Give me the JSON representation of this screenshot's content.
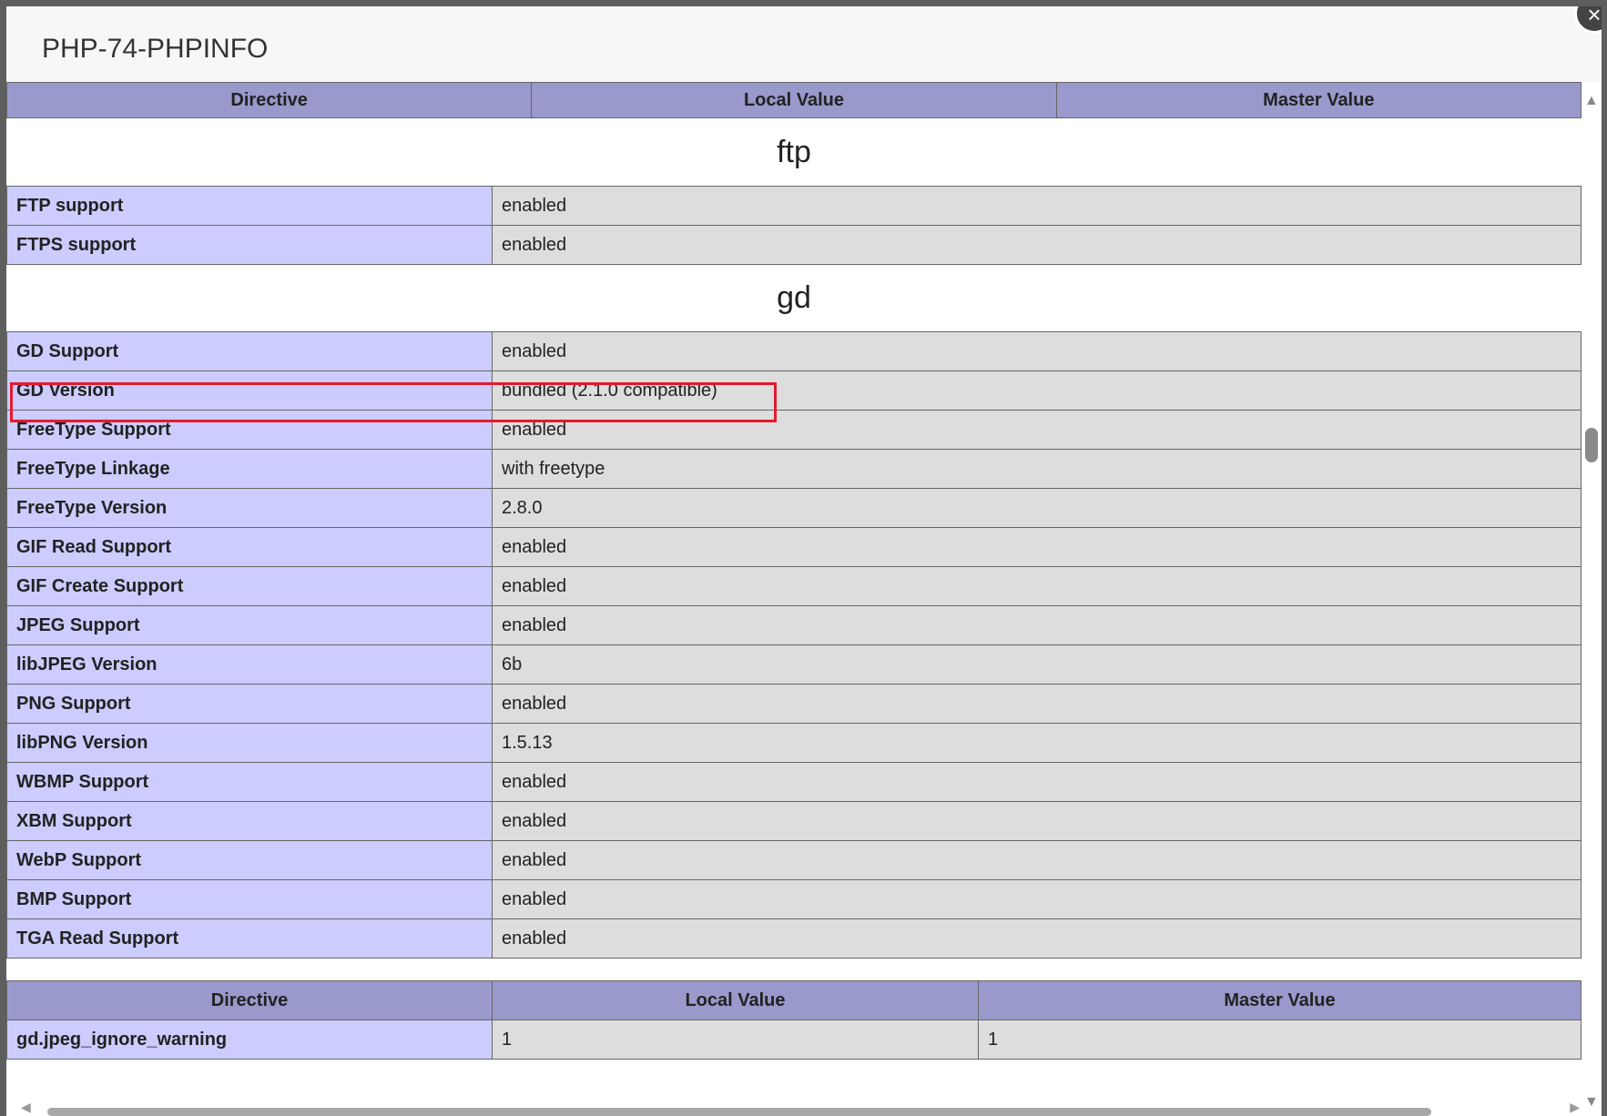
{
  "dialog": {
    "title": "PHP-74-PHPINFO",
    "close_icon": "×"
  },
  "header_columns": [
    "Directive",
    "Local Value",
    "Master Value"
  ],
  "sections": {
    "ftp": {
      "title": "ftp",
      "rows": [
        {
          "name": "FTP support",
          "value": "enabled"
        },
        {
          "name": "FTPS support",
          "value": "enabled"
        }
      ]
    },
    "gd": {
      "title": "gd",
      "rows": [
        {
          "name": "GD Support",
          "value": "enabled"
        },
        {
          "name": "GD Version",
          "value": "bundled (2.1.0 compatible)"
        },
        {
          "name": "FreeType Support",
          "value": "enabled"
        },
        {
          "name": "FreeType Linkage",
          "value": "with freetype"
        },
        {
          "name": "FreeType Version",
          "value": "2.8.0"
        },
        {
          "name": "GIF Read Support",
          "value": "enabled"
        },
        {
          "name": "GIF Create Support",
          "value": "enabled"
        },
        {
          "name": "JPEG Support",
          "value": "enabled"
        },
        {
          "name": "libJPEG Version",
          "value": "6b"
        },
        {
          "name": "PNG Support",
          "value": "enabled"
        },
        {
          "name": "libPNG Version",
          "value": "1.5.13"
        },
        {
          "name": "WBMP Support",
          "value": "enabled"
        },
        {
          "name": "XBM Support",
          "value": "enabled"
        },
        {
          "name": "WebP Support",
          "value": "enabled"
        },
        {
          "name": "BMP Support",
          "value": "enabled"
        },
        {
          "name": "TGA Read Support",
          "value": "enabled"
        }
      ],
      "directives": [
        {
          "name": "gd.jpeg_ignore_warning",
          "local": "1",
          "master": "1"
        }
      ]
    }
  },
  "colors": {
    "header_bg": "#9999cc",
    "directive_bg": "#ccccff",
    "value_bg": "#dddddd",
    "highlight_border": "#e31b2e"
  }
}
